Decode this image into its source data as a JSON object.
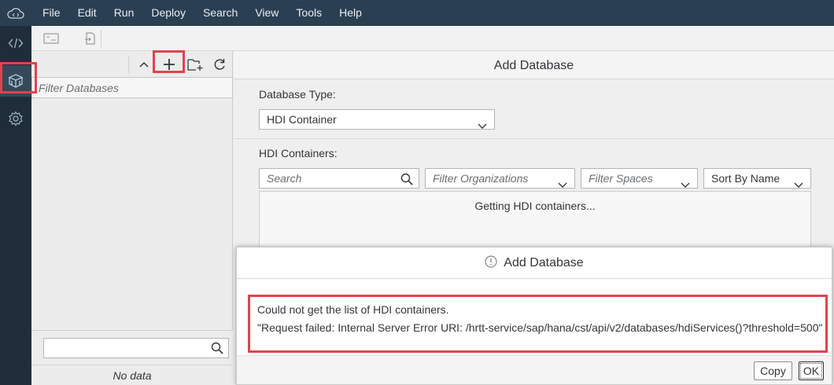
{
  "menubar": {
    "logo_icon": "cloud-code-icon",
    "items": [
      "File",
      "Edit",
      "Run",
      "Deploy",
      "Search",
      "View",
      "Tools",
      "Help"
    ]
  },
  "activitybar": {
    "items": [
      {
        "icon": "code-icon",
        "active": false
      },
      {
        "icon": "database-explorer-icon",
        "active": true
      },
      {
        "icon": "settings-gear-icon",
        "active": false
      }
    ]
  },
  "left_panel": {
    "filter_placeholder": "Filter Databases",
    "search_placeholder": "",
    "empty_text": "No data",
    "toolbar_icons": [
      "collapse-up-icon",
      "add-icon",
      "add-folder-icon",
      "refresh-icon"
    ]
  },
  "main": {
    "title": "Add Database",
    "database_type_label": "Database Type:",
    "database_type_value": "HDI Container",
    "hdi_containers_label": "HDI Containers:",
    "search_placeholder": "Search",
    "filter_orgs_placeholder": "Filter Organizations",
    "filter_spaces_placeholder": "Filter Spaces",
    "sort_value": "Sort By Name",
    "loading_text": "Getting HDI containers..."
  },
  "dialog": {
    "title": "Add Database",
    "message_line1": "Could not get the list of HDI containers.",
    "message_line2": "\"Request failed: Internal Server Error URI: /hrtt-service/sap/hana/cst/api/v2/databases/hdiServices()?threshold=500\"",
    "copy_label": "Copy",
    "ok_label": "OK"
  },
  "colors": {
    "menubar_bg": "#2b3f52",
    "activitybar_bg": "#1f2d3a",
    "highlight": "#e2434b"
  }
}
